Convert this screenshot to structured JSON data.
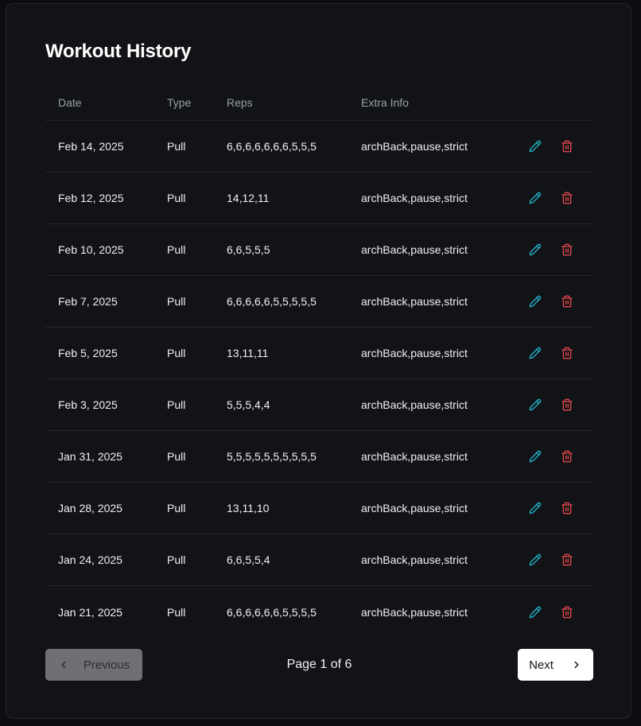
{
  "title": "Workout History",
  "columns": {
    "date": "Date",
    "type": "Type",
    "reps": "Reps",
    "extra": "Extra Info"
  },
  "rows": [
    {
      "date": "Feb 14, 2025",
      "type": "Pull",
      "reps": "6,6,6,6,6,6,6,5,5,5",
      "extra": "archBack,pause,strict"
    },
    {
      "date": "Feb 12, 2025",
      "type": "Pull",
      "reps": "14,12,11",
      "extra": "archBack,pause,strict"
    },
    {
      "date": "Feb 10, 2025",
      "type": "Pull",
      "reps": "6,6,5,5,5",
      "extra": "archBack,pause,strict"
    },
    {
      "date": "Feb 7, 2025",
      "type": "Pull",
      "reps": "6,6,6,6,6,5,5,5,5,5",
      "extra": "archBack,pause,strict"
    },
    {
      "date": "Feb 5, 2025",
      "type": "Pull",
      "reps": "13,11,11",
      "extra": "archBack,pause,strict"
    },
    {
      "date": "Feb 3, 2025",
      "type": "Pull",
      "reps": "5,5,5,4,4",
      "extra": "archBack,pause,strict"
    },
    {
      "date": "Jan 31, 2025",
      "type": "Pull",
      "reps": "5,5,5,5,5,5,5,5,5,5",
      "extra": "archBack,pause,strict"
    },
    {
      "date": "Jan 28, 2025",
      "type": "Pull",
      "reps": "13,11,10",
      "extra": "archBack,pause,strict"
    },
    {
      "date": "Jan 24, 2025",
      "type": "Pull",
      "reps": "6,6,5,5,4",
      "extra": "archBack,pause,strict"
    },
    {
      "date": "Jan 21, 2025",
      "type": "Pull",
      "reps": "6,6,6,6,6,6,5,5,5,5",
      "extra": "archBack,pause,strict"
    }
  ],
  "icons": {
    "edit": "pencil-icon",
    "delete": "trash-icon"
  },
  "colors": {
    "edit": "#22b8cf",
    "delete": "#e5484d"
  },
  "pagination": {
    "previous_label": "Previous",
    "next_label": "Next",
    "page_text": "Page 1 of 6",
    "current_page": 1,
    "total_pages": 6,
    "previous_disabled": true
  }
}
